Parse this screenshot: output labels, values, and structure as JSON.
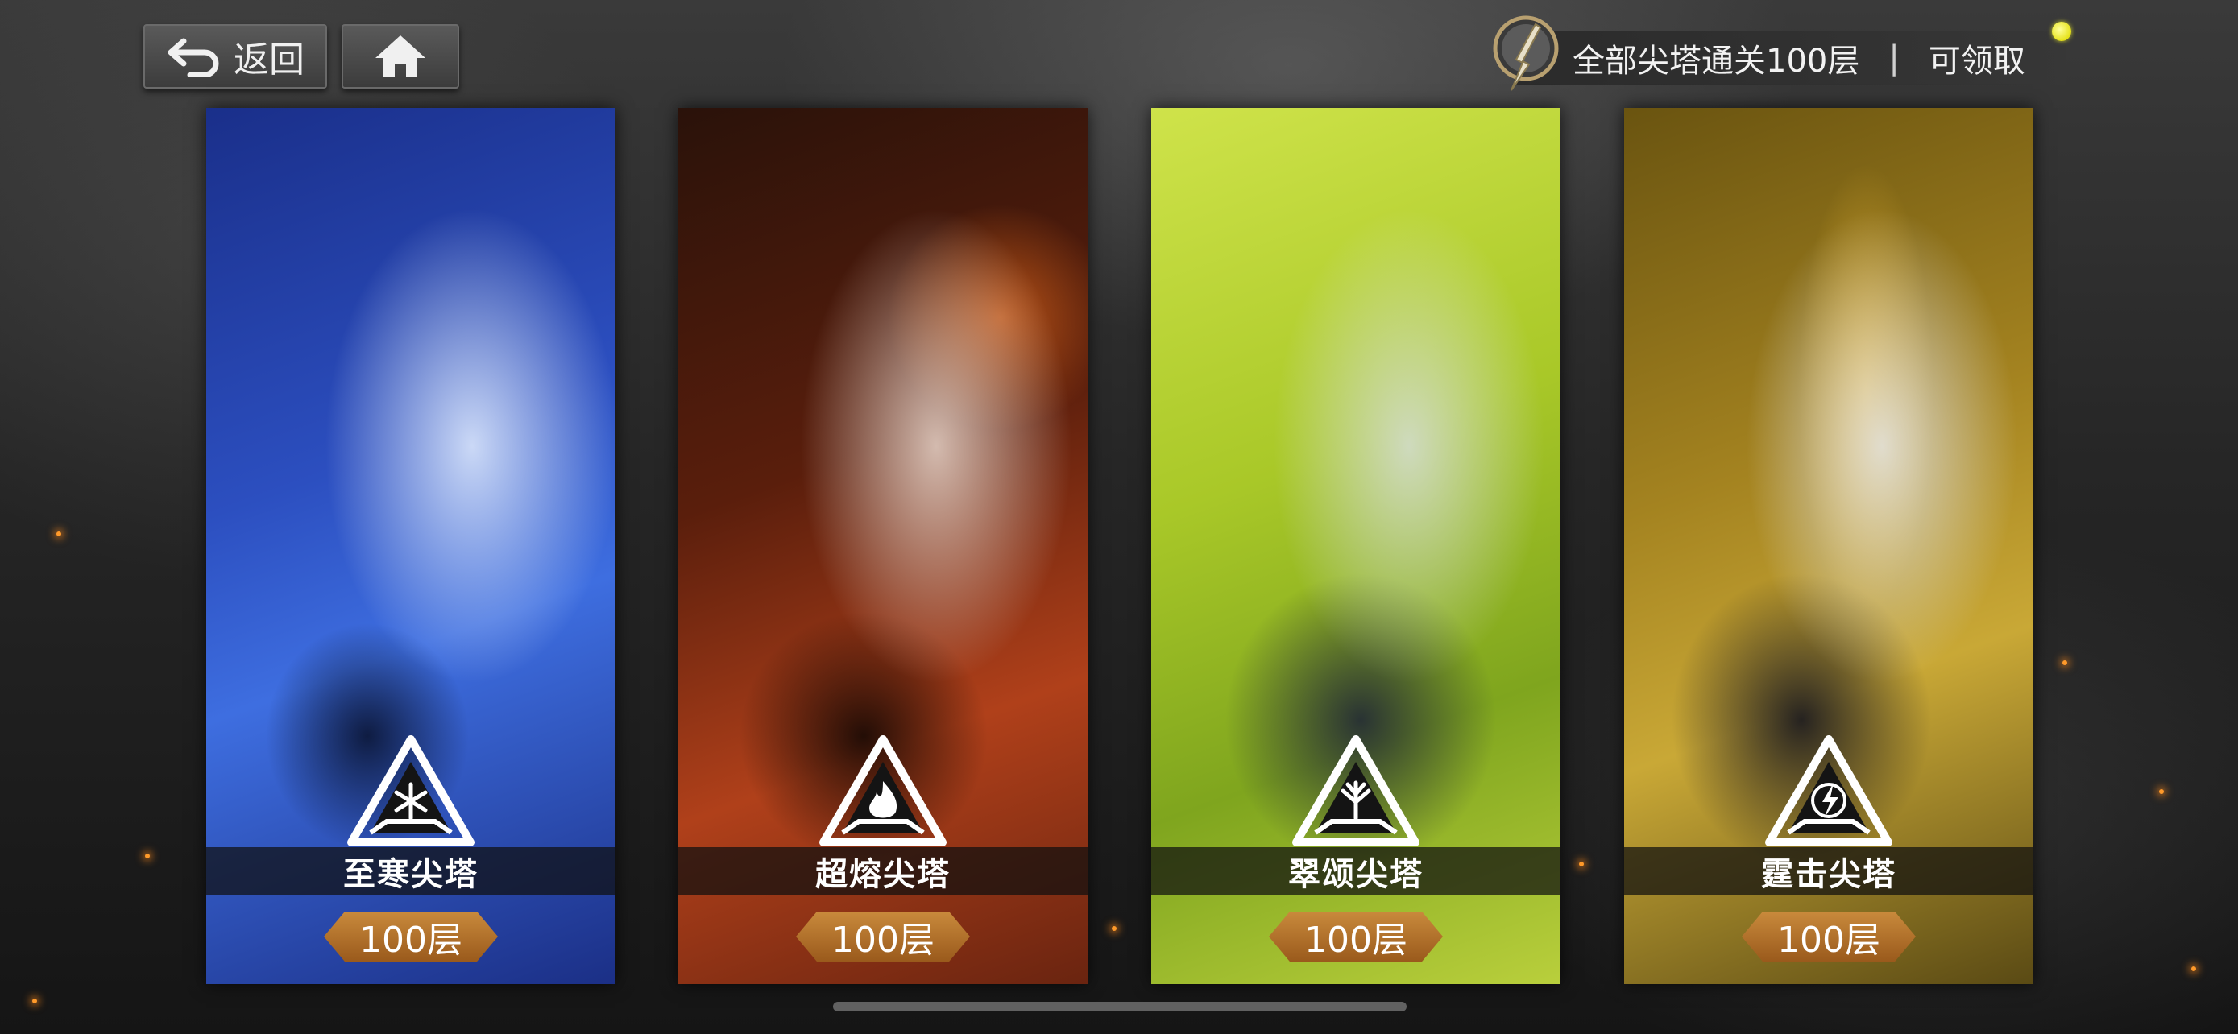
{
  "header": {
    "back_label": "返回",
    "reward_title": "全部尖塔通关100层",
    "reward_separator": "|",
    "reward_status": "可领取"
  },
  "towers": [
    {
      "name": "至寒尖塔",
      "floor": "100层",
      "element": "ice",
      "emblem_icon": "snowflake-icon"
    },
    {
      "name": "超熔尖塔",
      "floor": "100层",
      "element": "fire",
      "emblem_icon": "flame-icon"
    },
    {
      "name": "翠颂尖塔",
      "floor": "100层",
      "element": "nature",
      "emblem_icon": "tree-icon"
    },
    {
      "name": "霆击尖塔",
      "floor": "100层",
      "element": "thunder",
      "emblem_icon": "lightning-icon"
    }
  ],
  "colors": {
    "floor_badge": "#b5742c",
    "notify_dot": "#e6e21a",
    "ice": "#2c4fc0",
    "fire": "#b0401a",
    "nature": "#a9c828",
    "thunder": "#a48320"
  }
}
